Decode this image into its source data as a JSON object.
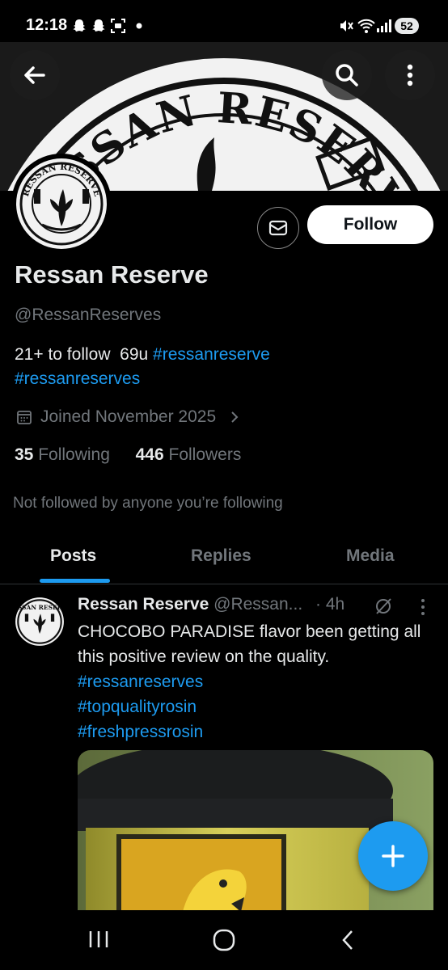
{
  "status_bar": {
    "time": "12:18",
    "battery": "52"
  },
  "banner": {
    "text": "RESSAN RESERVE"
  },
  "avatar": {
    "text": "RESSAN RESERVE"
  },
  "profile": {
    "display_name": "Ressan Reserve",
    "handle": "@RessanReserves",
    "bio_text": "21+ to follow  69u ",
    "bio_tags": [
      "#ressanreserve",
      "#ressanreserves"
    ],
    "joined": "Joined November 2025",
    "following_count": "35",
    "following_label": "Following",
    "followers_count": "446",
    "followers_label": "Followers",
    "not_followed": "Not followed by anyone you’re following"
  },
  "actions": {
    "follow_label": "Follow"
  },
  "tabs": [
    {
      "label": "Posts",
      "active": true
    },
    {
      "label": "Replies",
      "active": false
    },
    {
      "label": "Media",
      "active": false
    }
  ],
  "post": {
    "author": "Ressan Reserve",
    "handle": "@Ressan...",
    "time": "· 4h",
    "text": "CHOCOBO PARADISE flavor been getting all this positive review on the quality.",
    "hashtags": [
      "#ressanreserves",
      "#topqualityrosin",
      "#freshpressrosin"
    ]
  },
  "colors": {
    "accent": "#1d9bf0",
    "background": "#000000",
    "text": "#e7e9ea",
    "muted": "#71767b"
  }
}
